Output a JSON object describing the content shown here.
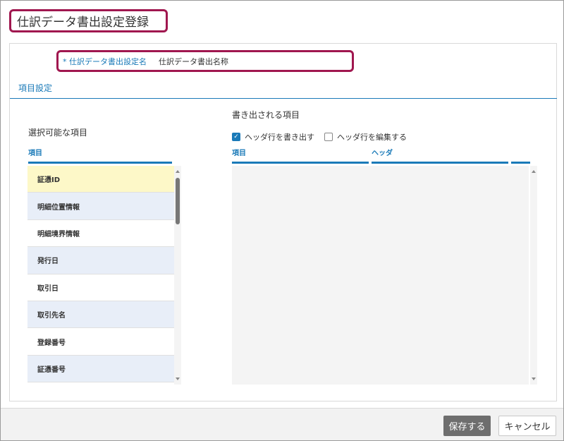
{
  "header": {
    "title": "仕訳データ書出設定登録"
  },
  "name_field": {
    "required_mark": "*",
    "label": "仕訳データ書出設定名",
    "value": "仕訳データ書出名称"
  },
  "section": {
    "title": "項目設定"
  },
  "available": {
    "heading": "選択可能な項目",
    "column_header": "項目",
    "items": [
      {
        "label": "証憑ID",
        "state": "selected"
      },
      {
        "label": "明細位置情報",
        "state": "alt"
      },
      {
        "label": "明細境界情報",
        "state": "plain"
      },
      {
        "label": "発行日",
        "state": "alt"
      },
      {
        "label": "取引日",
        "state": "plain"
      },
      {
        "label": "取引先名",
        "state": "alt"
      },
      {
        "label": "登録番号",
        "state": "plain"
      },
      {
        "label": "証憑番号",
        "state": "alt"
      }
    ]
  },
  "export": {
    "heading": "書き出される項目",
    "header_row_checkbox": {
      "label": "ヘッダ行を書き出す",
      "checked": true
    },
    "edit_header_checkbox": {
      "label": "ヘッダ行を編集する",
      "checked": false
    },
    "columns": [
      "項目",
      "ヘッダ",
      ""
    ]
  },
  "footer": {
    "save_label": "保存する",
    "cancel_label": "キャンセル"
  },
  "colors": {
    "accent": "#1a7ab8",
    "highlight_border": "#a0174f",
    "selected_row": "#fdf8c8",
    "alt_row": "#e8eef8",
    "save_button": "#6e6e6e"
  }
}
